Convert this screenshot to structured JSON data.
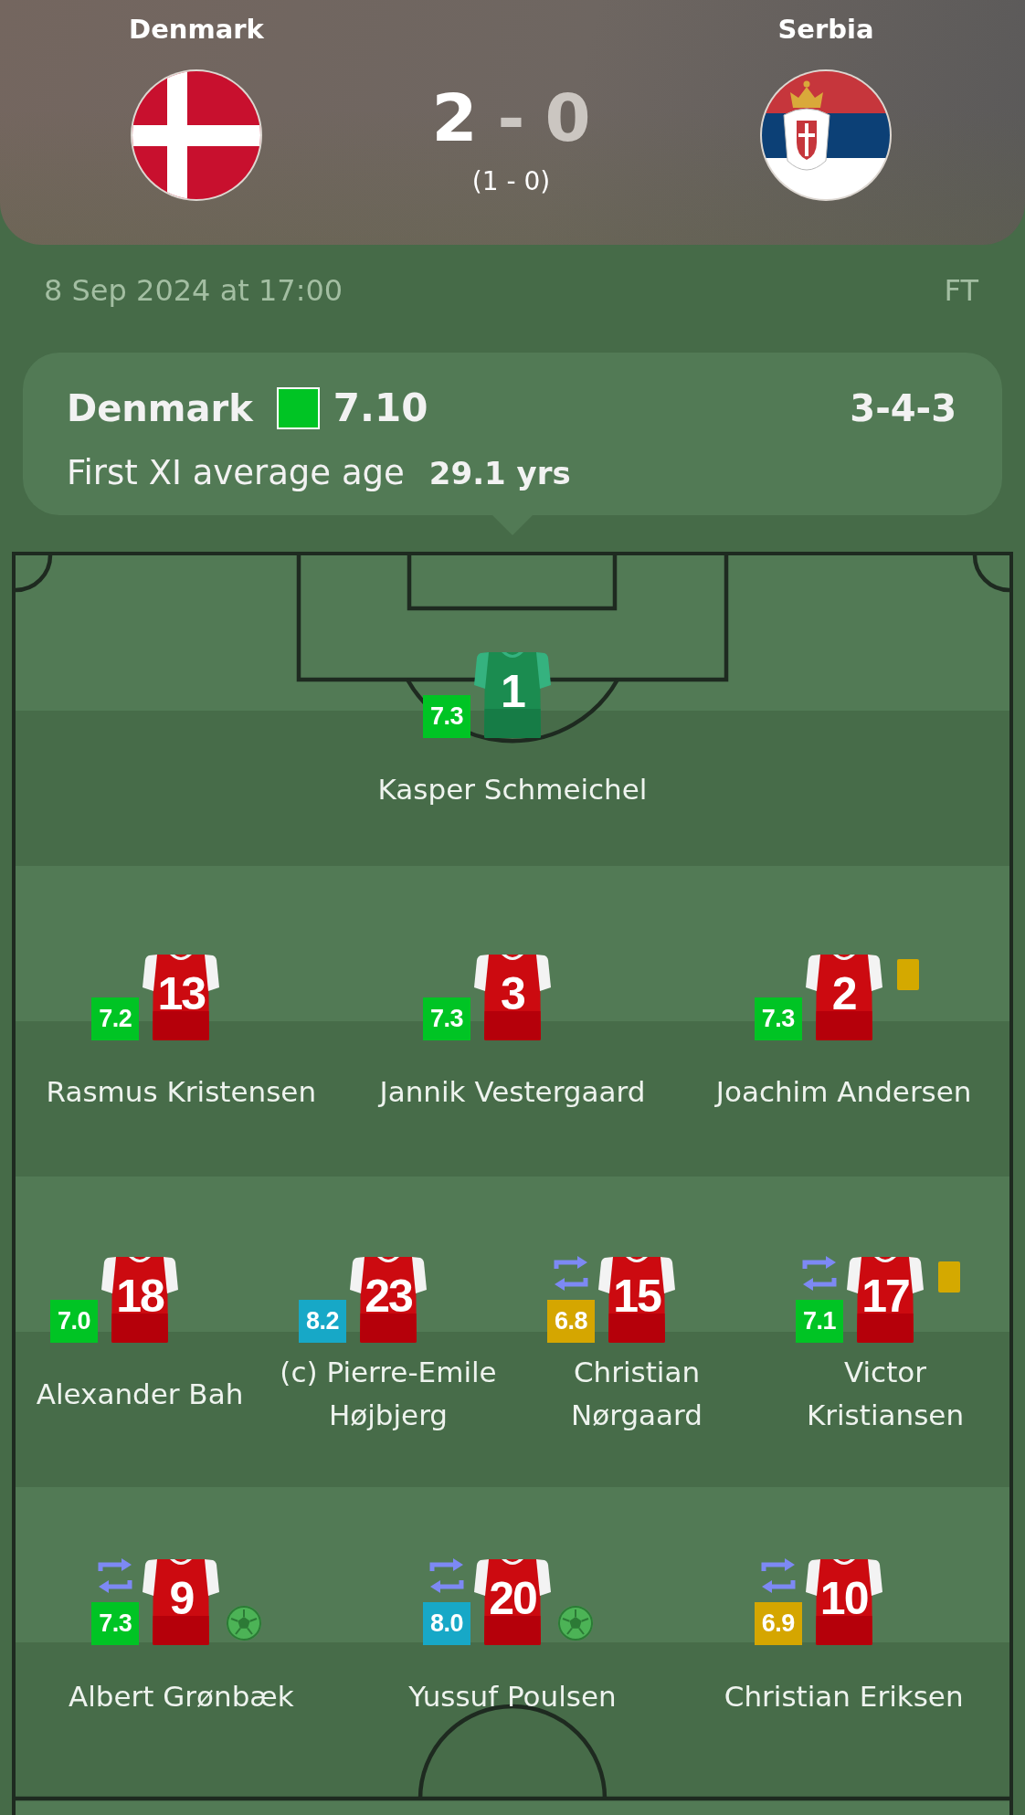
{
  "match": {
    "home": {
      "name": "Denmark"
    },
    "away": {
      "name": "Serbia"
    },
    "score": {
      "home": {
        "value": "2",
        "leading": true
      },
      "separator": "-",
      "away": {
        "value": "0",
        "leading": false
      }
    },
    "halftime": "(1 - 0)",
    "date": "8 Sep 2024 at 17:00",
    "status": "FT"
  },
  "team_summary": {
    "name": "Denmark",
    "color": "#00c424",
    "rating": "7.10",
    "formation": "3-4-3",
    "age_label": "First XI average age",
    "age_value": "29.1 yrs"
  },
  "lineup": {
    "lines": [
      {
        "players": [
          {
            "kind": "goalkeeper",
            "number": "1",
            "name": "Kasper Schmeichel",
            "rating": "7.3",
            "color": "#00c424",
            "substituted": false,
            "yellow_card": false,
            "goal": false
          }
        ]
      },
      {
        "players": [
          {
            "kind": "outfield",
            "number": "13",
            "name": "Rasmus Kristensen",
            "rating": "7.2",
            "color": "#00c424",
            "substituted": false,
            "yellow_card": false,
            "goal": false
          },
          {
            "kind": "outfield",
            "number": "3",
            "name": "Jannik Vestergaard",
            "rating": "7.3",
            "color": "#00c424",
            "substituted": false,
            "yellow_card": false,
            "goal": false
          },
          {
            "kind": "outfield",
            "number": "2",
            "name": "Joachim Andersen",
            "rating": "7.3",
            "color": "#00c424",
            "substituted": false,
            "yellow_card": true,
            "goal": false
          }
        ]
      },
      {
        "players": [
          {
            "kind": "outfield",
            "number": "18",
            "name": "Alexander Bah",
            "rating": "7.0",
            "color": "#00c424",
            "substituted": false,
            "yellow_card": false,
            "goal": false
          },
          {
            "kind": "outfield",
            "number": "23",
            "name": "(c) Pierre-Emile Højbjerg",
            "rating": "8.2",
            "color": "#17a8c7",
            "substituted": false,
            "yellow_card": false,
            "goal": false
          },
          {
            "kind": "outfield",
            "number": "15",
            "name": "Christian Nørgaard",
            "rating": "6.8",
            "color": "#d5a600",
            "substituted": true,
            "yellow_card": false,
            "goal": false
          },
          {
            "kind": "outfield",
            "number": "17",
            "name": "Victor Kristiansen",
            "rating": "7.1",
            "color": "#00c424",
            "substituted": true,
            "yellow_card": true,
            "goal": false
          }
        ]
      },
      {
        "players": [
          {
            "kind": "outfield",
            "number": "9",
            "name": "Albert Grønbæk",
            "rating": "7.3",
            "color": "#00c424",
            "substituted": true,
            "yellow_card": false,
            "goal": true
          },
          {
            "kind": "outfield",
            "number": "20",
            "name": "Yussuf Poulsen",
            "rating": "8.0",
            "color": "#17a8c7",
            "substituted": true,
            "yellow_card": false,
            "goal": true
          },
          {
            "kind": "outfield",
            "number": "10",
            "name": "Christian Eriksen",
            "rating": "6.9",
            "color": "#d5a600",
            "substituted": true,
            "yellow_card": false,
            "goal": false
          }
        ]
      }
    ]
  }
}
